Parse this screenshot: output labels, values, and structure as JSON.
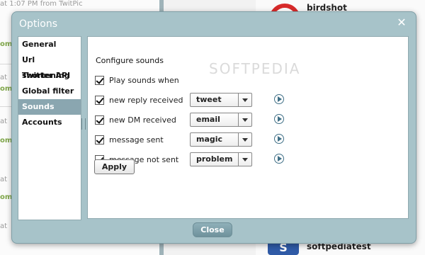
{
  "background": {
    "tweet_times": [
      "at 1:07 PM from TwitPic",
      "at",
      "at",
      "at",
      "at",
      "at",
      "at",
      "at"
    ],
    "marks": [
      "om",
      "om",
      "om",
      "om",
      "om",
      "om"
    ],
    "names": [
      "birdshot",
      "softpediatest"
    ],
    "avatar_letter": "S"
  },
  "dialog": {
    "title": "Options",
    "close_icon": "close-icon",
    "nav": [
      {
        "label": "General"
      },
      {
        "label": "Url shortening"
      },
      {
        "label": "Twitter API"
      },
      {
        "label": "Global filter"
      },
      {
        "label": "Sounds",
        "active": true
      },
      {
        "label": "Accounts"
      }
    ],
    "sounds": {
      "heading": "Configure sounds",
      "play_sounds_when": {
        "label": "Play sounds when",
        "checked": true
      },
      "rows": [
        {
          "label": "new reply received",
          "checked": true,
          "sound": "tweet"
        },
        {
          "label": "new DM received",
          "checked": true,
          "sound": "email"
        },
        {
          "label": "message sent",
          "checked": true,
          "sound": "magic"
        },
        {
          "label": "message not sent",
          "checked": true,
          "sound": "problem"
        }
      ],
      "apply_label": "Apply"
    },
    "close_label": "Close",
    "watermark": "SOFTPEDIA"
  }
}
